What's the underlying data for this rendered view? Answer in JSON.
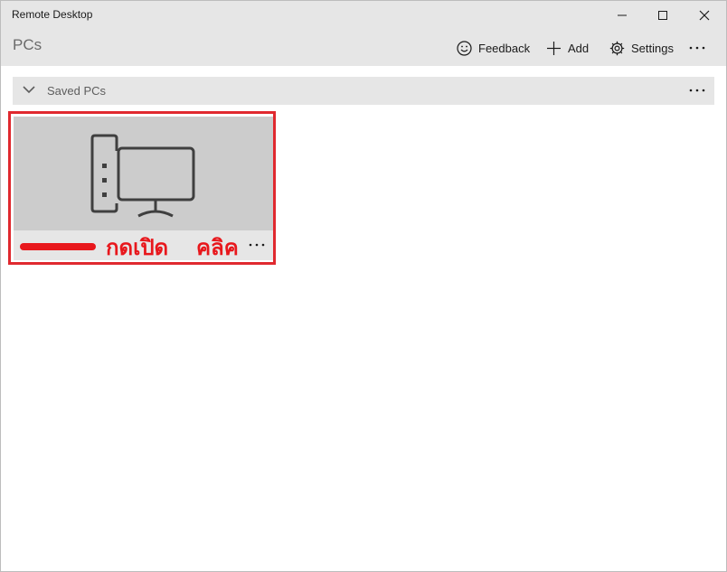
{
  "window": {
    "title": "Remote Desktop",
    "controls": [
      "minimize",
      "maximize",
      "close"
    ]
  },
  "header": {
    "page_title": "PCs",
    "toolbar": {
      "feedback_label": "Feedback",
      "add_label": "Add",
      "settings_label": "Settings"
    },
    "icons": [
      "smiley-icon",
      "plus-icon",
      "gear-icon",
      "more-icon"
    ]
  },
  "group": {
    "label": "Saved PCs",
    "expanded": true
  },
  "tile": {
    "icon": "desktop-pc-icon",
    "name_redacted": true
  },
  "annotations": {
    "open_text": "กดเปิด",
    "click_text": "คลิค",
    "color": "#e0292f"
  },
  "colors": {
    "chrome": "#e6e6e6",
    "tile_image": "#cccccc",
    "text": "#1a1a1a"
  }
}
